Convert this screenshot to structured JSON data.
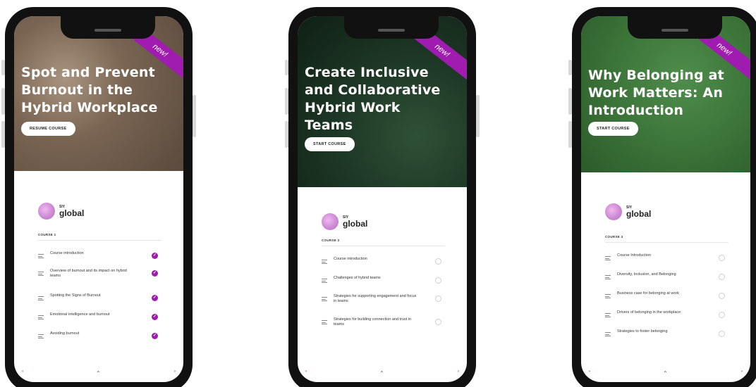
{
  "badge": "new!",
  "phones": [
    {
      "hero_title_lines": [
        "Spot and Prevent",
        "Burnout in the",
        "Hybrid Workplace"
      ],
      "cta_label": "RESUME COURSE",
      "brand_small": "SIY",
      "brand_word": "global",
      "course_label": "COURSE 1",
      "lessons": [
        {
          "title": "Course introduction",
          "status": "completed"
        },
        {
          "title": "Overview of burnout and its impact on hybrid teams",
          "status": "completed"
        },
        {
          "title": "Spotting the Signs of Burnout",
          "status": "completed"
        },
        {
          "title": "Emotional intelligence and burnout",
          "status": "completed"
        },
        {
          "title": "Avoiding burnout",
          "status": "completed"
        }
      ]
    },
    {
      "hero_title_lines": [
        "Create Inclusive",
        "and Collaborative",
        "Hybrid Work",
        "Teams"
      ],
      "cta_label": "START COURSE",
      "brand_small": "SIY",
      "brand_word": "global",
      "course_label": "COURSE 2",
      "lessons": [
        {
          "title": "Course introduction",
          "status": "not-started"
        },
        {
          "title": "Challenges of hybrid teams",
          "status": "not-started"
        },
        {
          "title": "Strategies for supporting engagement and focus in teams",
          "status": "not-started"
        },
        {
          "title": "Strategies for building connection and trust in teams",
          "status": "not-started"
        }
      ]
    },
    {
      "hero_title_lines": [
        "Why Belonging at",
        "Work Matters: An",
        "Introduction"
      ],
      "cta_label": "START COURSE",
      "brand_small": "SIY",
      "brand_word": "global",
      "course_label": "COURSE 3",
      "lessons": [
        {
          "title": "Course Introduction",
          "status": "not-started"
        },
        {
          "title": "Diversity, Inclusion, and Belonging",
          "status": "not-started"
        },
        {
          "title": "Business case for belonging at work",
          "status": "not-started"
        },
        {
          "title": "Drivers of belonging in the workplace",
          "status": "not-started"
        },
        {
          "title": "Strategies to foster belonging",
          "status": "not-started"
        }
      ]
    }
  ],
  "colors": {
    "accent": "#a01bb0",
    "hero1": "#8b7765",
    "hero2": "#1f3a26",
    "hero3": "#3f7a40"
  },
  "icons": {
    "lesson": "lesson-lines-icon",
    "completed": "check-circle-icon",
    "pending": "empty-circle-icon",
    "nav": "chevron-up-icon"
  }
}
